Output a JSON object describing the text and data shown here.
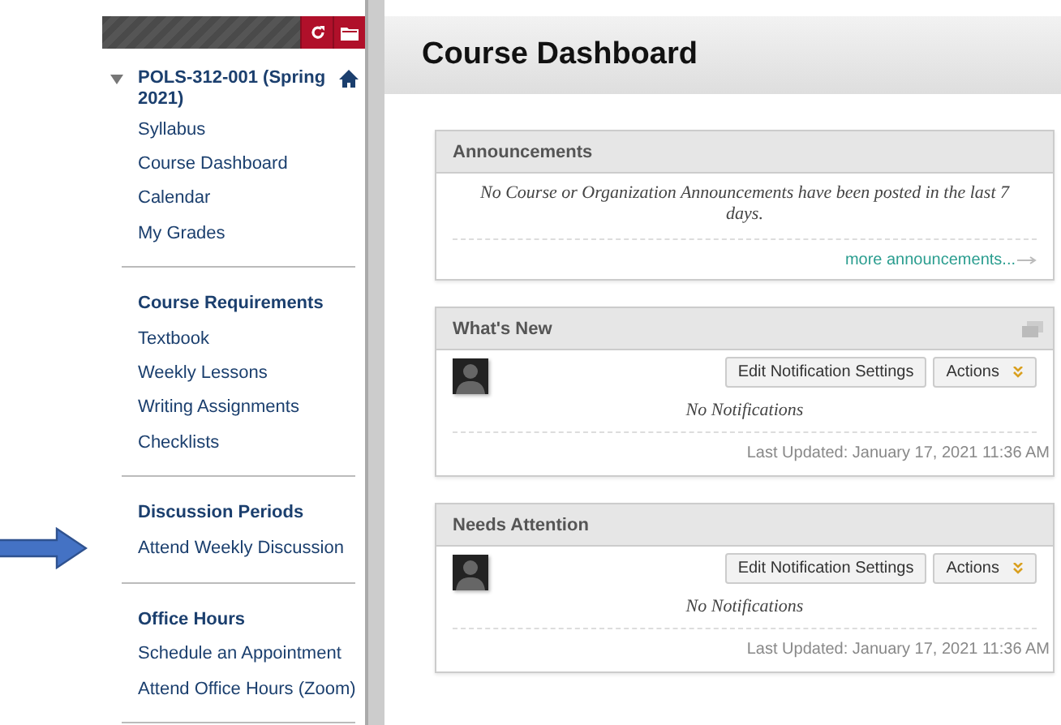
{
  "course": {
    "title": "POLS-312-001 (Spring 2021)",
    "expanded": true
  },
  "sidebar": {
    "sections": [
      {
        "items": [
          {
            "label": "Syllabus"
          },
          {
            "label": "Course Dashboard"
          },
          {
            "label": "Calendar"
          },
          {
            "label": "My Grades"
          }
        ]
      },
      {
        "heading": "Course Requirements",
        "items": [
          {
            "label": "Textbook"
          },
          {
            "label": "Weekly Lessons"
          },
          {
            "label": "Writing Assignments"
          },
          {
            "label": "Checklists"
          }
        ]
      },
      {
        "heading": "Discussion Periods",
        "items": [
          {
            "label": "Attend Weekly Discussion",
            "pointed": true
          }
        ]
      },
      {
        "heading": "Office Hours",
        "items": [
          {
            "label": "Schedule an Appointment"
          },
          {
            "label": "Attend Office Hours (Zoom)"
          }
        ]
      }
    ]
  },
  "page_title": "Course Dashboard",
  "modules": [
    {
      "kind": "announcements",
      "title": "Announcements",
      "header_icon": false,
      "message": "No Course or Organization Announcements have been posted in the last 7 days.",
      "link": "more announcements..."
    },
    {
      "kind": "notifications",
      "title": "What's New",
      "header_icon": true,
      "buttons": [
        "Edit Notification Settings",
        "Actions"
      ],
      "message": "No Notifications",
      "updated": "Last Updated: January 17, 2021 11:36 AM"
    },
    {
      "kind": "notifications",
      "title": "Needs Attention",
      "header_icon": false,
      "buttons": [
        "Edit Notification Settings",
        "Actions"
      ],
      "message": "No Notifications",
      "updated": "Last Updated: January 17, 2021 11:36 AM"
    }
  ]
}
